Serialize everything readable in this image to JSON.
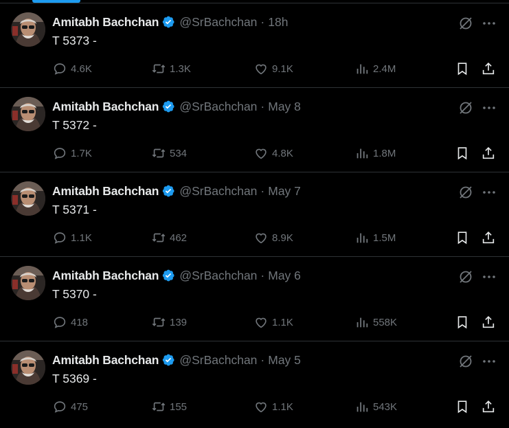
{
  "tweets": [
    {
      "name": "Amitabh Bachchan",
      "handle": "@SrBachchan",
      "separator": "·",
      "time": "18h",
      "text": "T 5373 -",
      "replies": "4.6K",
      "retweets": "1.3K",
      "likes": "9.1K",
      "views": "2.4M"
    },
    {
      "name": "Amitabh Bachchan",
      "handle": "@SrBachchan",
      "separator": "·",
      "time": "May 8",
      "text": "T 5372 -",
      "replies": "1.7K",
      "retweets": "534",
      "likes": "4.8K",
      "views": "1.8M"
    },
    {
      "name": "Amitabh Bachchan",
      "handle": "@SrBachchan",
      "separator": "·",
      "time": "May 7",
      "text": "T 5371 -",
      "replies": "1.1K",
      "retweets": "462",
      "likes": "8.9K",
      "views": "1.5M"
    },
    {
      "name": "Amitabh Bachchan",
      "handle": "@SrBachchan",
      "separator": "·",
      "time": "May 6",
      "text": "T 5370 -",
      "replies": "418",
      "retweets": "139",
      "likes": "1.1K",
      "views": "558K"
    },
    {
      "name": "Amitabh Bachchan",
      "handle": "@SrBachchan",
      "separator": "·",
      "time": "May 5",
      "text": "T 5369 -",
      "replies": "475",
      "retweets": "155",
      "likes": "1.1K",
      "views": "543K"
    }
  ],
  "icons": {
    "verified": "verified-badge-icon",
    "grok": "grok-icon",
    "more": "more-icon",
    "reply": "reply-icon",
    "retweet": "retweet-icon",
    "like": "heart-icon",
    "views": "views-icon",
    "bookmark": "bookmark-icon",
    "share": "share-icon"
  },
  "colors": {
    "background": "#000000",
    "text": "#e7e9ea",
    "muted": "#71767b",
    "divider": "#2f3336",
    "accent": "#1d9bf0"
  }
}
